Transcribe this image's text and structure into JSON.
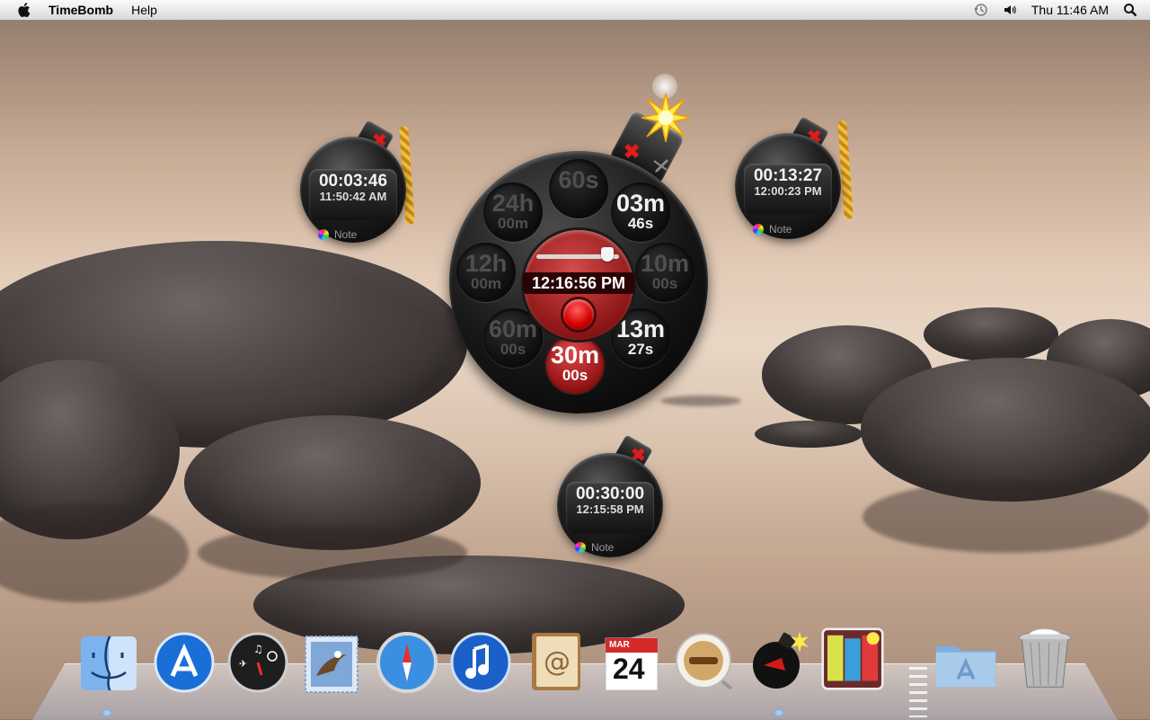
{
  "menubar": {
    "app_name": "TimeBomb",
    "items": [
      "Help"
    ],
    "clock": "Thu 11:46 AM"
  },
  "colors": {
    "bomb_red": "#e21c1c",
    "dial_center_red": "#b52a2a",
    "timer_text": "#f2f2f2"
  },
  "timers": [
    {
      "remaining": "00:03:46",
      "alarm_time": "11:50:42 AM",
      "note": "Note",
      "fuse": "rope"
    },
    {
      "remaining": "00:13:27",
      "alarm_time": "12:00:23 PM",
      "note": "Note",
      "fuse": "rope"
    },
    {
      "remaining": "00:30:00",
      "alarm_time": "12:15:58 PM",
      "note": "Note",
      "fuse": "none"
    }
  ],
  "dial": {
    "center_time": "12:16:56 PM",
    "slider_fraction": 0.86,
    "presets": [
      {
        "big": "60s",
        "small": "",
        "state": "dim"
      },
      {
        "big": "03m",
        "small": "46s",
        "state": "lit"
      },
      {
        "big": "10m",
        "small": "00s",
        "state": "dim"
      },
      {
        "big": "13m",
        "small": "27s",
        "state": "lit"
      },
      {
        "big": "30m",
        "small": "00s",
        "state": "red"
      },
      {
        "big": "60m",
        "small": "00s",
        "state": "dim"
      },
      {
        "big": "12h",
        "small": "00m",
        "state": "dim"
      },
      {
        "big": "24h",
        "small": "00m",
        "state": "dim"
      }
    ]
  },
  "dock": {
    "calendar_month": "MAR",
    "calendar_day": "24",
    "apps": [
      "finder-icon",
      "app-store-icon",
      "dashboard-icon",
      "mail-icon",
      "safari-icon",
      "itunes-icon",
      "address-book-icon",
      "ical-icon",
      "coffee-icon",
      "timebomb-icon",
      "you-icon",
      "applications-folder-icon",
      "trash-icon"
    ]
  }
}
